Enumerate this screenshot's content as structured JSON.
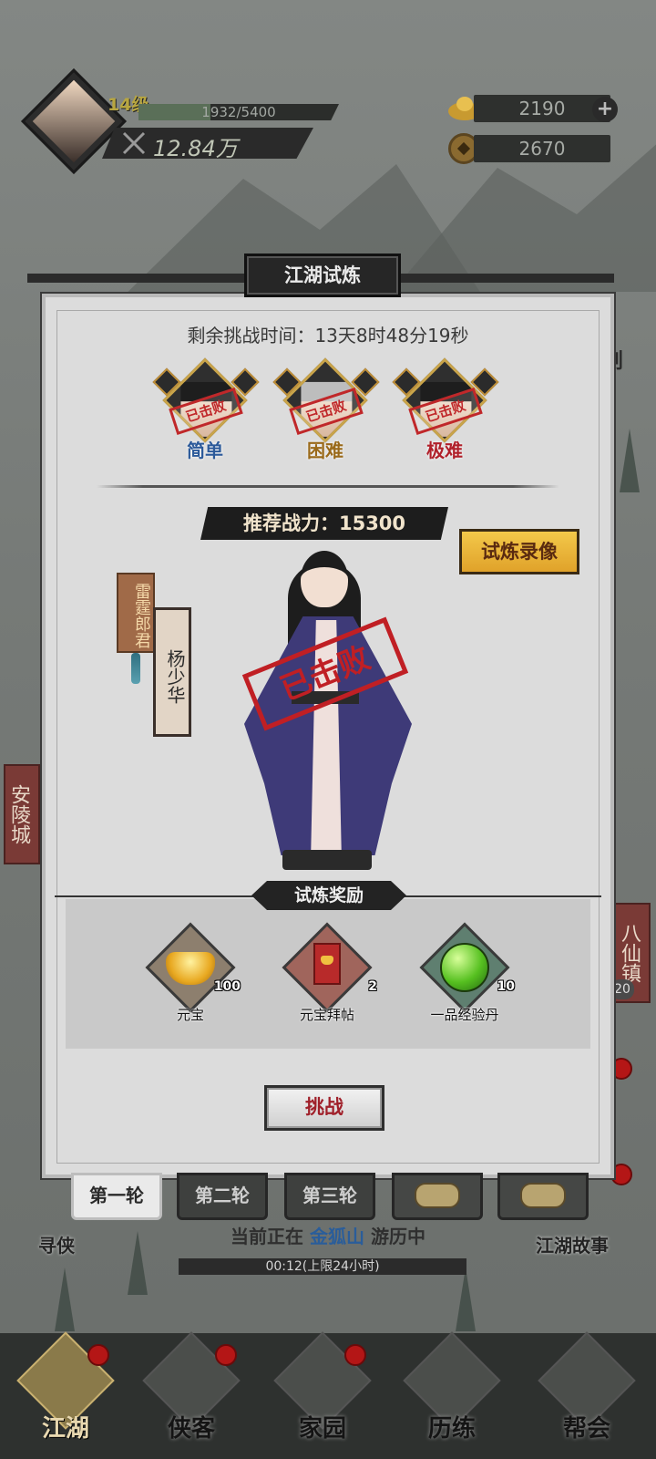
{
  "hud": {
    "level": "14级",
    "exp": "1932/5400",
    "exp_fraction": 0.358,
    "power": "12.84万",
    "gold": "2190",
    "coins": "2670"
  },
  "map": {
    "city_left": "安陵城",
    "town_right": "八仙镇",
    "town_badge": "20",
    "right_fragment": "划"
  },
  "modal": {
    "title": "江湖试炼",
    "remaining": "剩余挑战时间：13天8时48分19秒",
    "difficulties": [
      {
        "label": "简单",
        "stamp": "已击败",
        "icon": "hero-portrait-icon"
      },
      {
        "label": "困难",
        "stamp": "已击败",
        "icon": "hero-portrait-icon"
      },
      {
        "label": "极难",
        "stamp": "已击败",
        "icon": "hero-portrait-icon"
      }
    ],
    "recommended_power": "推荐战力：15300",
    "replay_button": "试炼录像",
    "hero_title": "雷霆郎君",
    "hero_name": "杨少华",
    "defeated_stamp": "已击败",
    "reward_title": "试炼奖励",
    "rewards": [
      {
        "name": "元宝",
        "count": "100",
        "icon": "gold-ingot-icon"
      },
      {
        "name": "元宝拜帖",
        "count": "2",
        "icon": "invite-card-icon"
      },
      {
        "name": "一品经验丹",
        "count": "10",
        "icon": "exp-pill-icon"
      }
    ],
    "challenge_button": "挑战"
  },
  "rounds": {
    "tabs": [
      "第一轮",
      "第二轮",
      "第三轮"
    ],
    "active": 0
  },
  "side_links": {
    "left": "寻侠",
    "right": "江湖故事"
  },
  "travel": {
    "prefix": "当前正在",
    "location": "金狐山",
    "suffix": "游历中",
    "timer": "00:12(上限24小时)"
  },
  "nav": [
    "江湖",
    "侠客",
    "家园",
    "历练",
    "帮会"
  ],
  "colors": {
    "accent_gold": "#e0a22a",
    "stamp_red": "#c01f24",
    "easy_blue": "#2c5a9a",
    "hard_orange": "#9a6a1a",
    "extreme_red": "#b0202a"
  }
}
